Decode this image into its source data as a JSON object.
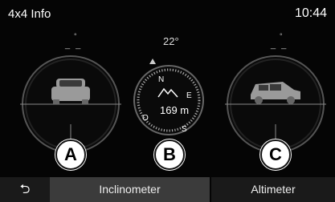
{
  "header": {
    "title": "4x4 Info",
    "clock": "10:44"
  },
  "readouts": {
    "left_dashes": "_ _",
    "left_deg": "°",
    "right_dashes": "_ _",
    "right_deg": "°",
    "compass_heading": "22°",
    "altitude": "169 m"
  },
  "compass": {
    "n": "N",
    "e": "E",
    "s": "S",
    "o": "O"
  },
  "markers": {
    "a": "A",
    "b": "B",
    "c": "C"
  },
  "tabs": {
    "back_icon": "⮌",
    "inclinometer": "Inclinometer",
    "altimeter": "Altimeter"
  },
  "colors": {
    "background": "#050505",
    "active_tab": "#3b3b3b",
    "inactive_tab": "#1a1a1a"
  }
}
